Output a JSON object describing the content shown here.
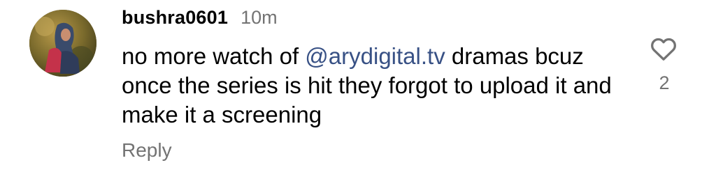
{
  "comment": {
    "username": "bushra0601",
    "time": "10m",
    "text_before": "no more watch of ",
    "mention": "@arydigital.tv",
    "text_after": " dramas bcuz once the series is hit they forgot to upload it and make it a screening",
    "reply_label": "Reply",
    "like_count": "2"
  },
  "colors": {
    "mention": "#385185",
    "secondary_text": "#737373"
  },
  "icons": {
    "like": "heart-outline-icon",
    "avatar": "user-avatar"
  }
}
